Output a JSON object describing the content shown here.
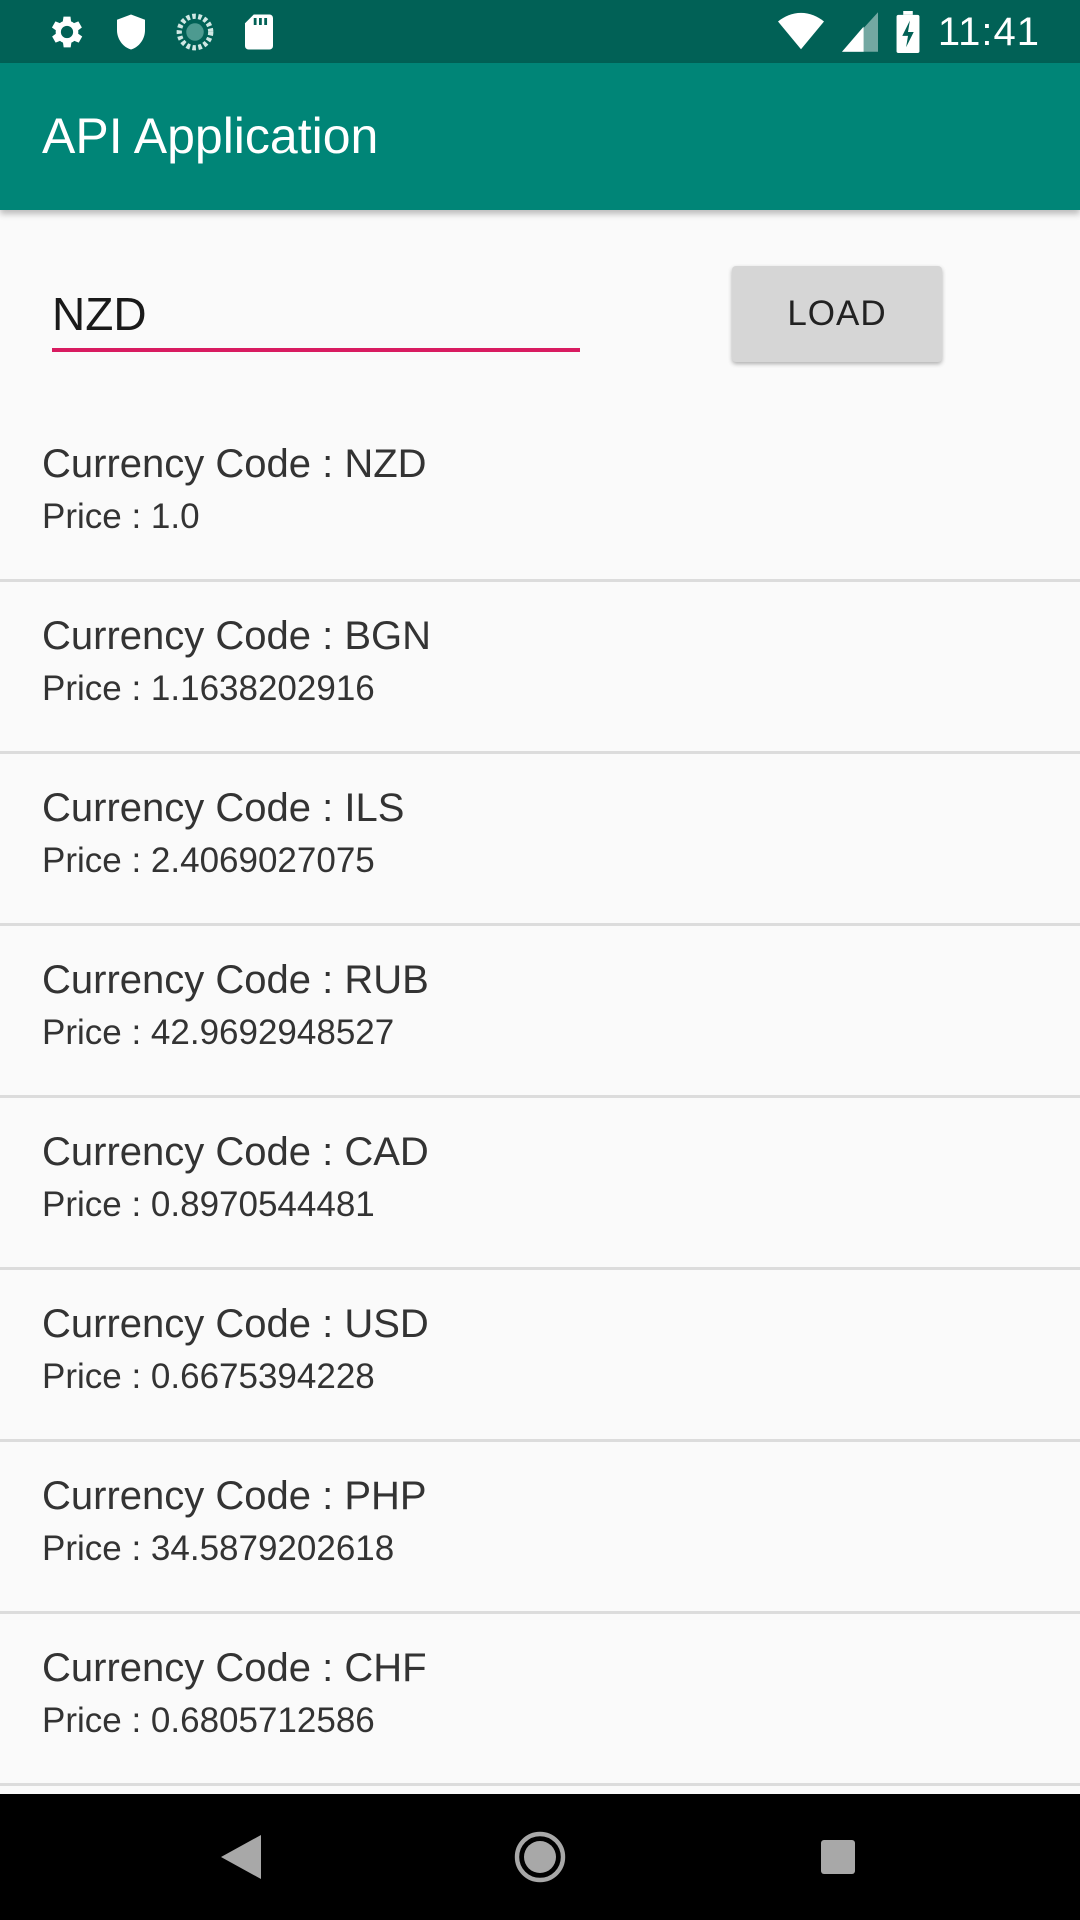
{
  "status_bar": {
    "time": "11:41",
    "left_icons": [
      "settings-gear-icon",
      "shield-icon",
      "sync-progress-icon",
      "sd-card-icon"
    ],
    "right_icons": [
      "wifi-icon",
      "cellular-signal-icon",
      "battery-charging-icon"
    ]
  },
  "app_bar": {
    "title": "API Application"
  },
  "search": {
    "value": "NZD",
    "load_label": "LOAD"
  },
  "currencies": [
    {
      "code_text": "Currency Code : NZD",
      "price_text": "Price : 1.0"
    },
    {
      "code_text": "Currency Code : BGN",
      "price_text": "Price : 1.1638202916"
    },
    {
      "code_text": "Currency Code : ILS",
      "price_text": "Price : 2.4069027075"
    },
    {
      "code_text": "Currency Code : RUB",
      "price_text": "Price : 42.9692948527"
    },
    {
      "code_text": "Currency Code : CAD",
      "price_text": "Price : 0.8970544481"
    },
    {
      "code_text": "Currency Code : USD",
      "price_text": "Price : 0.6675394228"
    },
    {
      "code_text": "Currency Code : PHP",
      "price_text": "Price : 34.5879202618"
    },
    {
      "code_text": "Currency Code : CHF",
      "price_text": "Price : 0.6805712586"
    }
  ],
  "nav_bar": {
    "buttons": [
      "back-icon",
      "home-icon",
      "recents-icon"
    ]
  },
  "colors": {
    "status_bar": "#016156",
    "primary": "#008577",
    "accent": "#d81b60",
    "background": "#fafafa"
  }
}
